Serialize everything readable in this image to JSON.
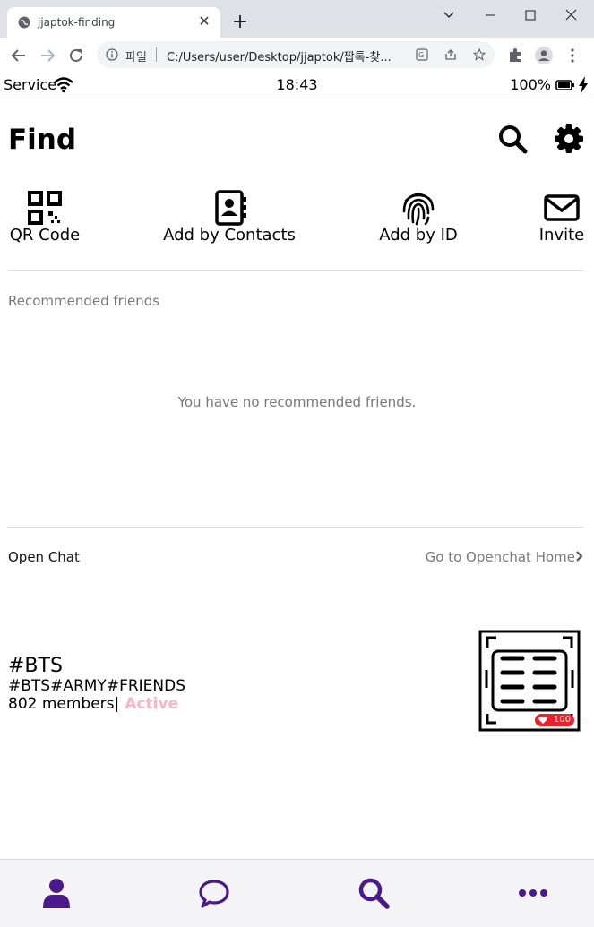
{
  "browser": {
    "tab_title": "jjaptok-finding",
    "new_tab": "+",
    "close_tab": "✕",
    "site_label": "파일",
    "url": "C:/Users/user/Desktop/jjaptok/짭톡-찾..."
  },
  "status": {
    "carrier": "Service",
    "time": "18:43",
    "battery": "100%"
  },
  "header": {
    "title": "Find"
  },
  "quick_actions": [
    {
      "label": "QR Code",
      "icon": "qr-code-icon"
    },
    {
      "label": "Add by Contacts",
      "icon": "contacts-book-icon"
    },
    {
      "label": "Add by ID",
      "icon": "fingerprint-icon"
    },
    {
      "label": "Invite",
      "icon": "envelope-icon"
    }
  ],
  "recommended": {
    "label": "Recommended friends",
    "empty_message": "You have no recommended friends."
  },
  "openchat": {
    "label": "Open Chat",
    "home_link": "Go to Openchat Home",
    "room": {
      "title": "#BTS",
      "tags": "#BTS#ARMY#FRIENDS",
      "members": "802 members|",
      "status": "Active",
      "likes": "100"
    }
  },
  "bottom_nav": [
    {
      "icon": "person-icon"
    },
    {
      "icon": "chat-bubble-icon"
    },
    {
      "icon": "search-icon"
    },
    {
      "icon": "more-icon"
    }
  ],
  "colors": {
    "accent": "#4a1a8c",
    "active": "#f7b6c8",
    "badge": "#e8222d"
  }
}
